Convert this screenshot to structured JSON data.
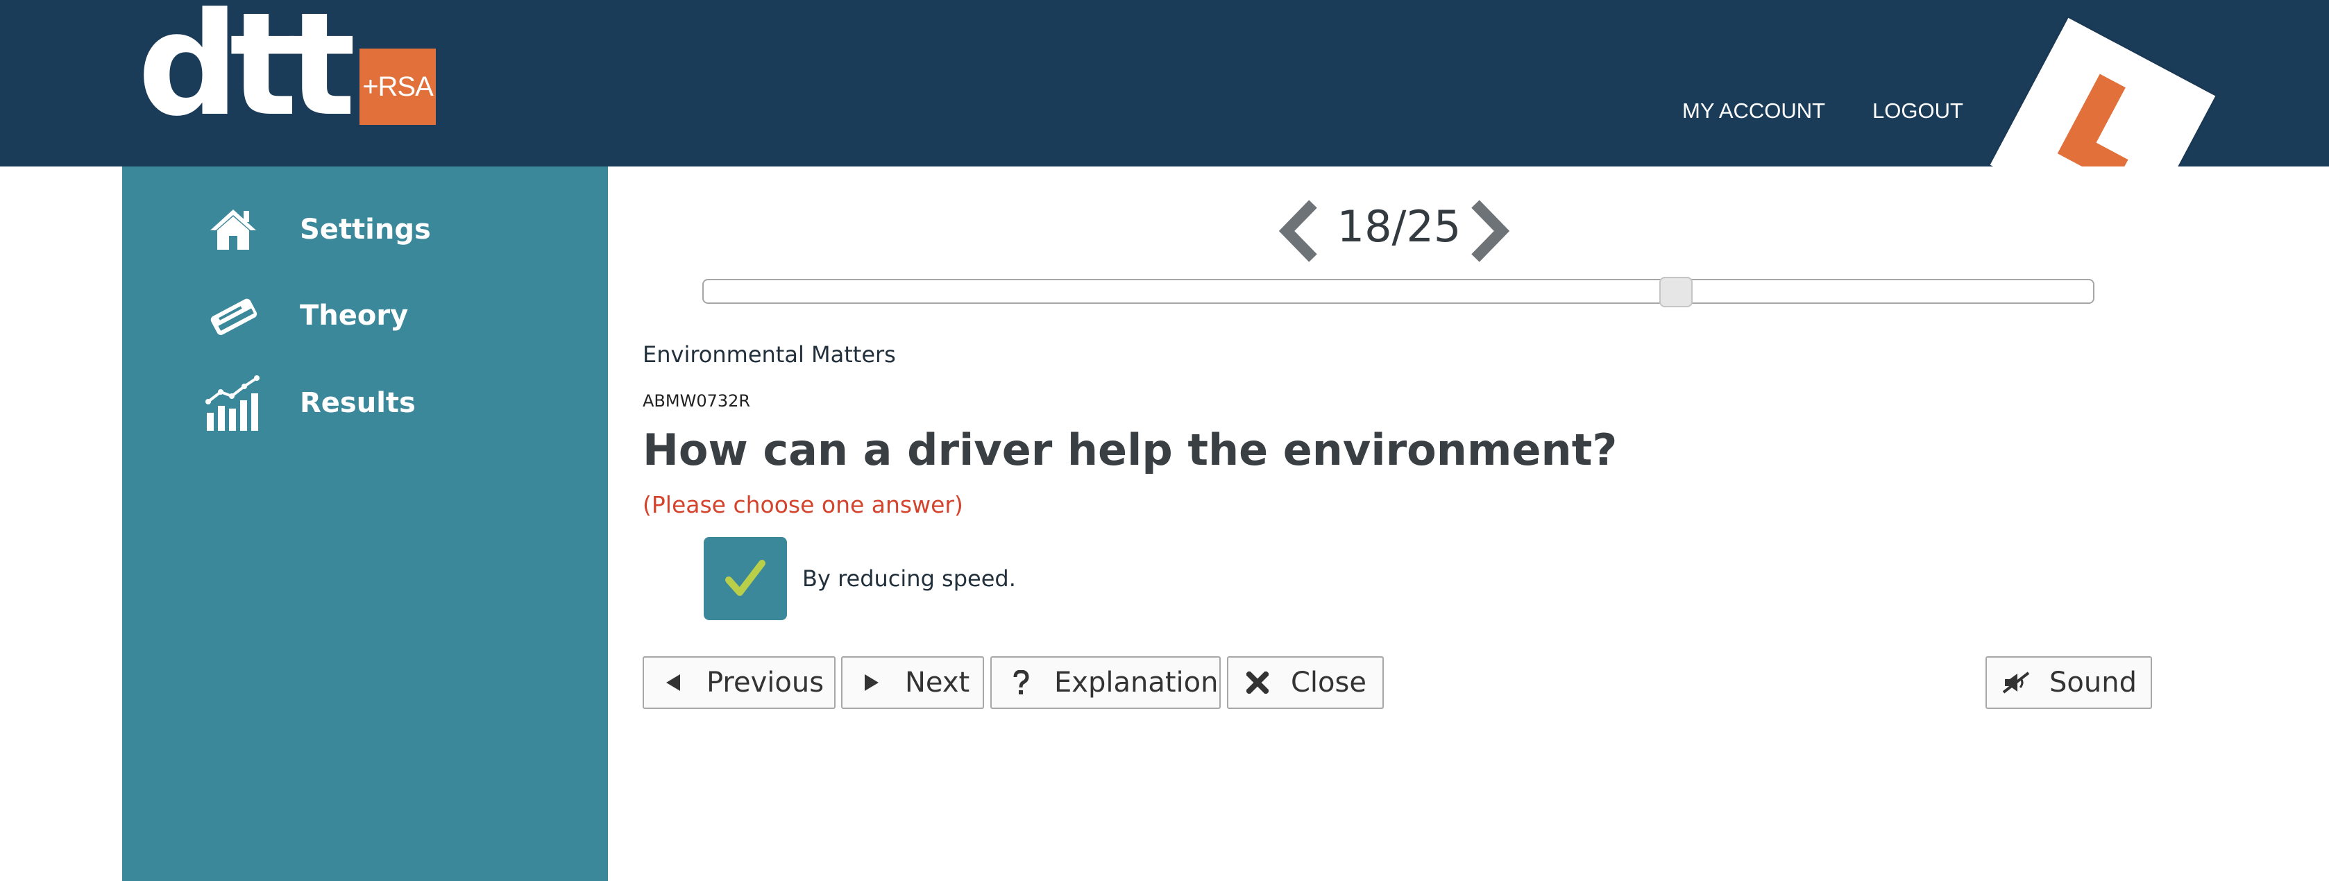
{
  "header": {
    "logo_text": "dtt",
    "logo_badge": "+RSA",
    "nav": {
      "my_account": "MY ACCOUNT",
      "logout": "LOGOUT"
    },
    "learner_plate_icon": "l-plate-icon",
    "colors": {
      "background": "#1b3c59",
      "badge": "#e2703b"
    }
  },
  "sidebar": {
    "color": "#3c889b",
    "items": [
      {
        "label": "Settings",
        "icon": "home-icon"
      },
      {
        "label": "Theory",
        "icon": "book-icon"
      },
      {
        "label": "Results",
        "icon": "chart-icon"
      }
    ]
  },
  "quiz": {
    "counter": "18/25",
    "current": 18,
    "total": 25,
    "category": "Environmental Matters",
    "code": "ABMW0732R",
    "question": "How can a driver help the environment?",
    "instruction": "(Please choose one answer)",
    "answers": [
      {
        "text": "By reducing speed.",
        "selected": true
      }
    ]
  },
  "buttons": {
    "previous": "Previous",
    "next": "Next",
    "explanation": "Explanation",
    "close": "Close",
    "sound": "Sound"
  }
}
